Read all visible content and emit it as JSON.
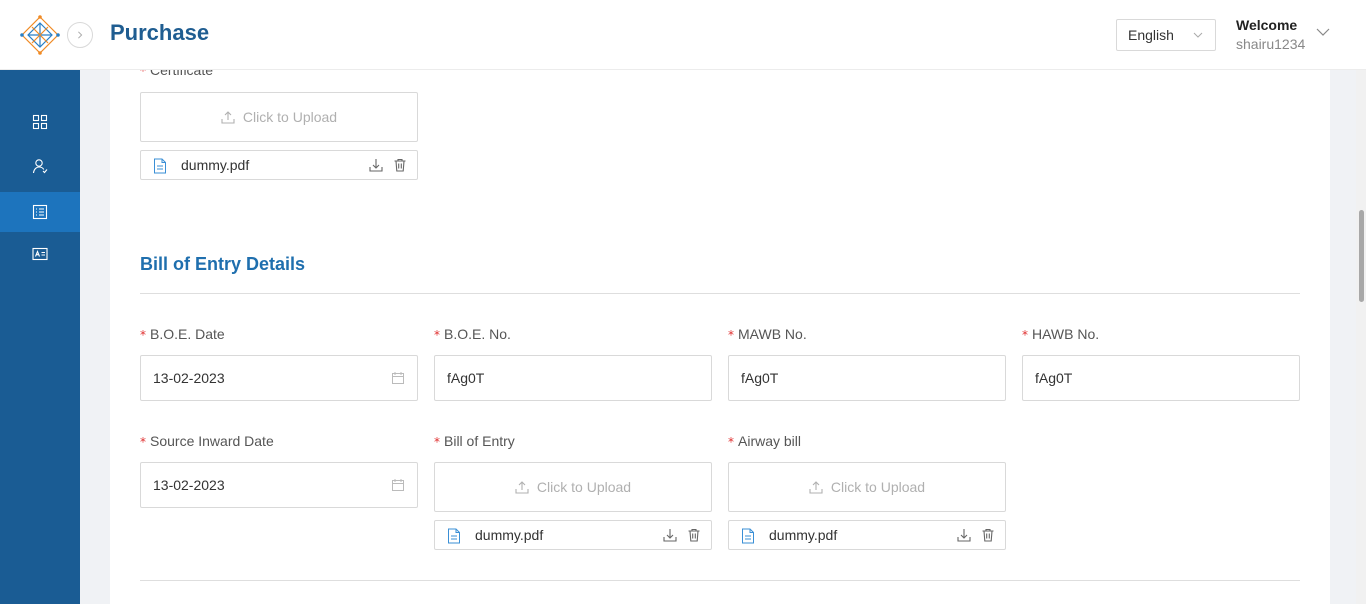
{
  "header": {
    "title": "Purchase",
    "language": "English",
    "welcome": "Welcome",
    "username": "shairu1234"
  },
  "sidebar": {
    "items": [
      {
        "icon": "dashboard-grid-icon",
        "active": false
      },
      {
        "icon": "users-icon",
        "active": false
      },
      {
        "icon": "list-document-icon",
        "active": true
      },
      {
        "icon": "id-card-icon",
        "active": false
      }
    ]
  },
  "certificate": {
    "label": "Certificate",
    "upload_label": "Click to Upload",
    "file_name": "dummy.pdf"
  },
  "boe_section": {
    "title": "Bill of Entry Details",
    "boe_date_label": "B.O.E. Date",
    "boe_date_value": "13-02-2023",
    "boe_no_label": "B.O.E. No.",
    "boe_no_value": "fAg0T",
    "mawb_label": "MAWB No.",
    "mawb_value": "fAg0T",
    "hawb_label": "HAWB No.",
    "hawb_value": "fAg0T",
    "source_inward_label": "Source Inward Date",
    "source_inward_value": "13-02-2023",
    "bill_of_entry_label": "Bill of Entry",
    "bill_of_entry_upload": "Click to Upload",
    "bill_of_entry_file": "dummy.pdf",
    "airway_bill_label": "Airway bill",
    "airway_bill_upload": "Click to Upload",
    "airway_bill_file": "dummy.pdf"
  },
  "required_mark": "*",
  "colors": {
    "sidebar": "#1a5c94",
    "sidebar_active": "#1d74bd",
    "title": "#1f5d91",
    "section_title": "#1f6fae",
    "required": "#e03030"
  }
}
